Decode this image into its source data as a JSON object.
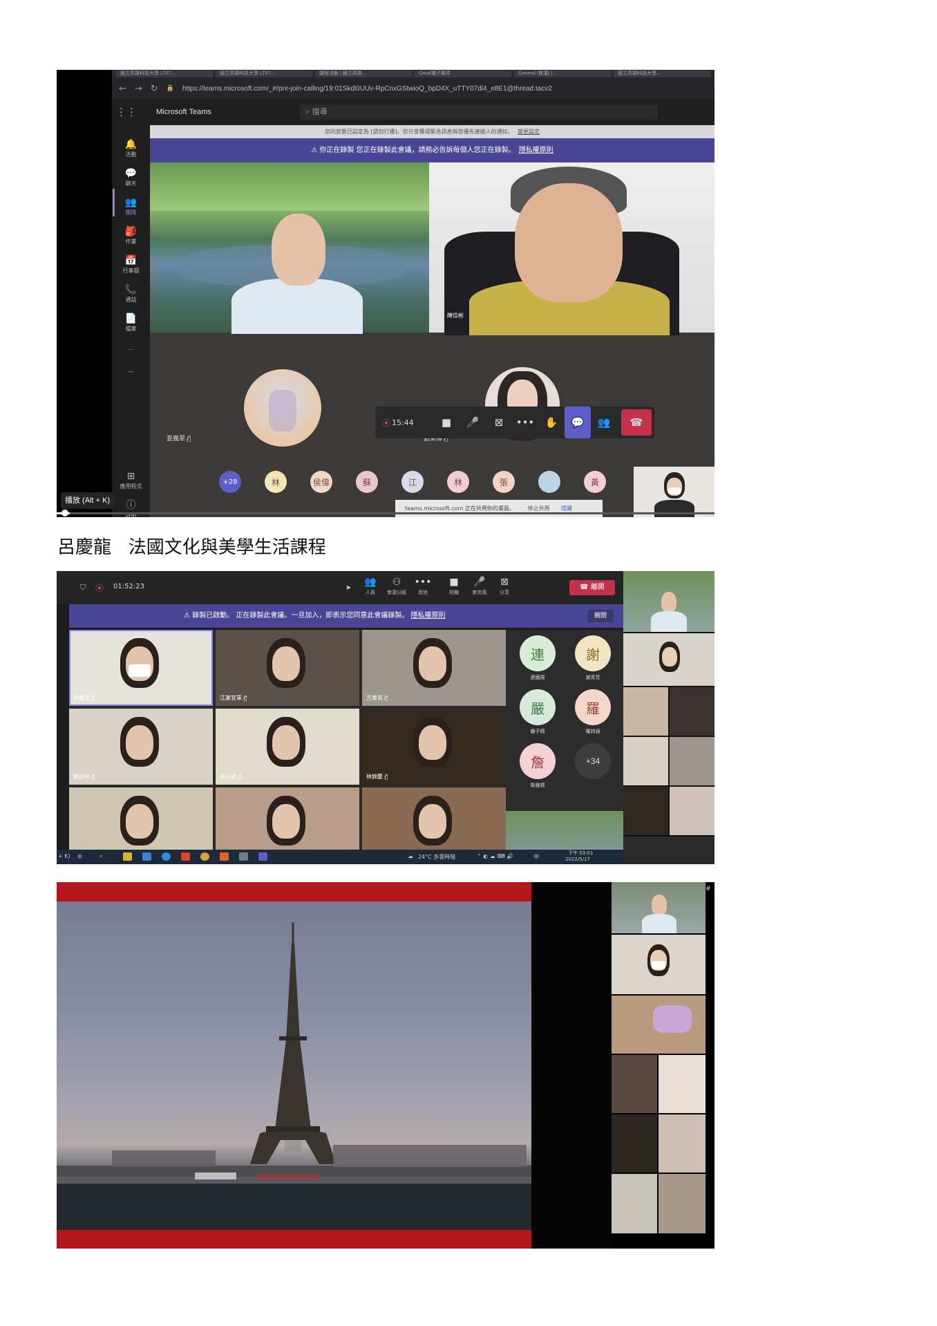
{
  "caption": "呂慶龍   法國文化與美學生活課程",
  "shot1": {
    "tabs": [
      "國立高雄科技大學 LT07...",
      "國立高雄科技大學 LT07...",
      "課程活動 | 國立高雄...",
      "Gmail電子郵件",
      "General (會議) | ...",
      "國立高雄科技大學..."
    ],
    "url": "https://teams.microsoft.com/_#/pre-join-calling/19:01Skdl0UUv-RpCnxGStwioQ_bpD4X_uTTY07dl4_e8E1@thread.tacv2",
    "app_name": "Microsoft Teams",
    "search_placeholder": "搜尋",
    "rail": [
      "活動",
      "聊天",
      "團隊",
      "作業",
      "行事曆",
      "通話",
      "檔案",
      "…",
      "應用程式",
      "說明"
    ],
    "notice": "您的狀態已設定為 [請勿打擾]。您只會獲得緊急訊息與您優先連絡人的通知。",
    "notice_link": "變更設定",
    "recording_banner": "你正在錄製 您正在錄製此會議，請務必告訴每個人您正在錄製。",
    "recording_link": "隱私權原則",
    "presenter_right_name": "陳信彬",
    "tile_left_name": "姜義翠",
    "tile_right_name": "劉東樺",
    "call_timer": "15:44",
    "roster_more": "+28",
    "roster": [
      "林",
      "侯偉",
      "蘇",
      "江",
      "林",
      "張",
      "",
      "黃"
    ],
    "roster_colors": [
      "#f1e6b8",
      "#f2d6c6",
      "#ecc6cf",
      "#d9d9ec",
      "#f2cdd3",
      "#f3d2c7",
      "#bcd3e6",
      "#f3cfd5"
    ],
    "share_notice": "teams.microsoft.com 正在共用你的畫面。",
    "stop_share": "停止共用",
    "hide": "隱藏",
    "play_tip": "播放 (Alt + K)",
    "progress": 0.02
  },
  "shot2": {
    "timer": "01:52:23",
    "toolbar": [
      {
        "icon": "people-icon",
        "glyph": "👥",
        "label": "人員"
      },
      {
        "icon": "rooms-icon",
        "glyph": "⚇",
        "label": "會議分組"
      },
      {
        "icon": "more-icon",
        "glyph": "•••",
        "label": "其他"
      },
      {
        "icon": "camera-icon",
        "glyph": "■",
        "label": "相機"
      },
      {
        "icon": "mic-icon",
        "glyph": "🎤",
        "label": "麥克風"
      },
      {
        "icon": "share-icon",
        "glyph": "⊠",
        "label": "分享"
      }
    ],
    "leave": "離開",
    "recording_banner": "錄製已啟動。  正在錄製此會議。一旦加入，即表示您同意此會議錄製。",
    "recording_link": "隱私權原則",
    "close_button": "關閉",
    "tiles": [
      {
        "name": "林慶文",
        "bg": "#e6e3dc"
      },
      {
        "name": "江謝宜軍",
        "bg": "#5a5248"
      },
      {
        "name": "方東英",
        "bg": "#9c968c"
      },
      {
        "name": "劉金梓",
        "bg": "#d8d2c8"
      },
      {
        "name": "蔡心穎",
        "bg": "#e2dccf"
      },
      {
        "name": "林錦慶",
        "bg": "#33291f"
      },
      {
        "name": "",
        "bg": "#cfc6b4"
      },
      {
        "name": "",
        "bg": "#b89e8a"
      },
      {
        "name": "",
        "bg": "#8a6a52"
      }
    ],
    "avatars": [
      {
        "char": "連",
        "name": "連國揚",
        "color": "#d9ecd8",
        "text": "#3f7a48"
      },
      {
        "char": "謝",
        "name": "謝青芳",
        "color": "#f0e6c4",
        "text": "#8a6f24"
      },
      {
        "char": "嚴",
        "name": "嚴子晴",
        "color": "#d7ead9",
        "text": "#3a7a4e"
      },
      {
        "char": "羅",
        "name": "羅詩涵",
        "color": "#f4d7cb",
        "text": "#9a4a32"
      },
      {
        "char": "詹",
        "name": "詹雅晴",
        "color": "#f5d1d5",
        "text": "#9a3644"
      }
    ],
    "more_count": "+34",
    "taskbar_weather": "24°C 多雲時陰",
    "taskbar_ime": "中",
    "taskbar_time": "下午 03:01",
    "taskbar_date": "2022/5/17",
    "taskbar_left": "+ K)"
  },
  "shot3": {
    "strip_title": "影片#"
  }
}
